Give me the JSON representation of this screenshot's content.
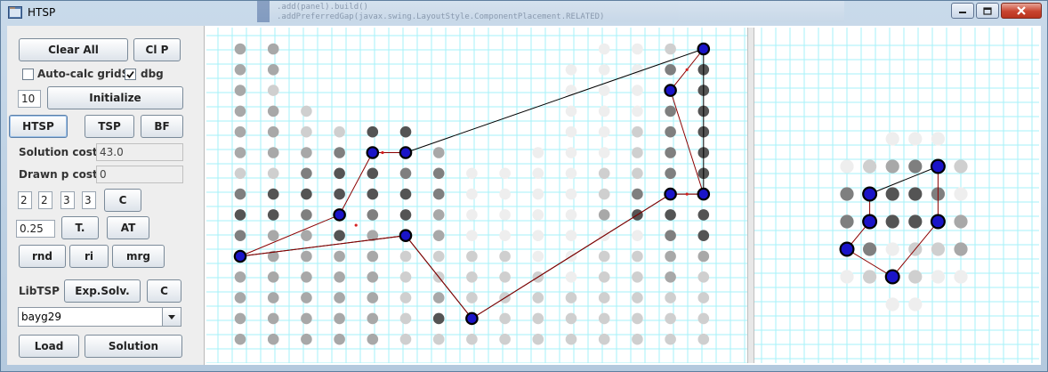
{
  "window": {
    "title": "HTSP"
  },
  "background_code": {
    "line1": "           .add(panel).build()",
    "line2": "           .addPreferredGap(javax.swing.LayoutStyle.ComponentPlacement.RELATED)"
  },
  "controls": {
    "clear_all": "Clear All",
    "cl_p": "Cl P",
    "auto_calc_label": "Auto-calc gridS.",
    "auto_calc_checked": false,
    "dbg_label": "dbg",
    "dbg_checked": true,
    "grid_size_value": "10",
    "initialize": "Initialize",
    "htsp": "HTSP",
    "tsp": "TSP",
    "bf": "BF",
    "solution_cost_label": "Solution cost",
    "solution_cost_value": "43.0",
    "drawn_cost_label": "Drawn p cost",
    "drawn_cost_value": "0",
    "params": [
      "2",
      "2",
      "3",
      "3"
    ],
    "c_button": "C",
    "t_value": "0.25",
    "t_button": "T.",
    "at_button": "AT",
    "rnd": "rnd",
    "ri": "ri",
    "mrg": "mrg",
    "libtsp_label": "LibTSP",
    "exp_solv": "Exp.Solv.",
    "c2_button": "C",
    "dataset": "bayg29",
    "load": "Load",
    "solution": "Solution"
  },
  "icons": {
    "window_minimize": "minimize-icon",
    "window_maximize": "maximize-icon",
    "window_close": "close-icon",
    "combo_arrow": "chevron-down-icon",
    "checkbox_check": "check-icon",
    "app": "app-icon"
  },
  "colors": {
    "tour_main": "#000000",
    "tour_sub": "#8b0000",
    "selected_node": "#1a14c8",
    "grid_line": "#a6f2f8",
    "level": [
      "#eeeeee",
      "#cfcfcf",
      "#a8a8a8",
      "#7f7f7f",
      "#545454",
      "#2a2a2a"
    ]
  },
  "main_grid": {
    "cols": 15,
    "rows": 15,
    "levels": [
      "330000000001125",
      "330000000011145",
      "320000000011135",
      "332000000011145",
      "332255000011245",
      "333455300111245",
      "224554411112245",
      "455555411112455",
      "554545311113555",
      "433533311111145",
      "433332222112233",
      "333332222212232",
      "333332322222222",
      "333332522222222",
      "333332222222222"
    ],
    "selected": [
      [
        14,
        0
      ],
      [
        13,
        2
      ],
      [
        4,
        5
      ],
      [
        5,
        5
      ],
      [
        13,
        7
      ],
      [
        14,
        7
      ],
      [
        3,
        8
      ],
      [
        5,
        9
      ],
      [
        0,
        10
      ],
      [
        7,
        13
      ]
    ],
    "tour_main": [
      [
        0,
        10
      ],
      [
        5,
        9
      ],
      [
        7,
        13
      ],
      [
        13,
        7
      ],
      [
        14,
        7
      ],
      [
        14,
        0
      ],
      [
        5,
        5
      ]
    ],
    "tour_sub": [
      [
        5,
        5
      ],
      [
        4,
        5
      ],
      [
        3,
        8
      ],
      [
        0,
        10
      ],
      [
        5,
        9
      ],
      [
        7,
        13
      ],
      [
        13,
        7
      ],
      [
        14,
        7
      ],
      [
        13,
        2
      ],
      [
        14,
        0
      ]
    ],
    "marks": [
      [
        4.3,
        5
      ],
      [
        3.5,
        8.5
      ],
      [
        13.5,
        1
      ],
      [
        13.5,
        7
      ]
    ]
  },
  "side_grid": {
    "cols": 6,
    "rows": 7,
    "levels": [
      "001110",
      "123442",
      "455541",
      "445523",
      "241223",
      "122211",
      "001100"
    ],
    "selected": [
      [
        4,
        1
      ],
      [
        1,
        2
      ],
      [
        1,
        3
      ],
      [
        4,
        3
      ],
      [
        0,
        4
      ],
      [
        2,
        5
      ]
    ],
    "tour_main": [
      [
        1,
        2
      ],
      [
        4,
        1
      ]
    ],
    "tour_sub": [
      [
        1,
        2
      ],
      [
        1,
        3
      ],
      [
        0,
        4
      ],
      [
        2,
        5
      ],
      [
        4,
        3
      ],
      [
        4,
        1
      ]
    ]
  }
}
